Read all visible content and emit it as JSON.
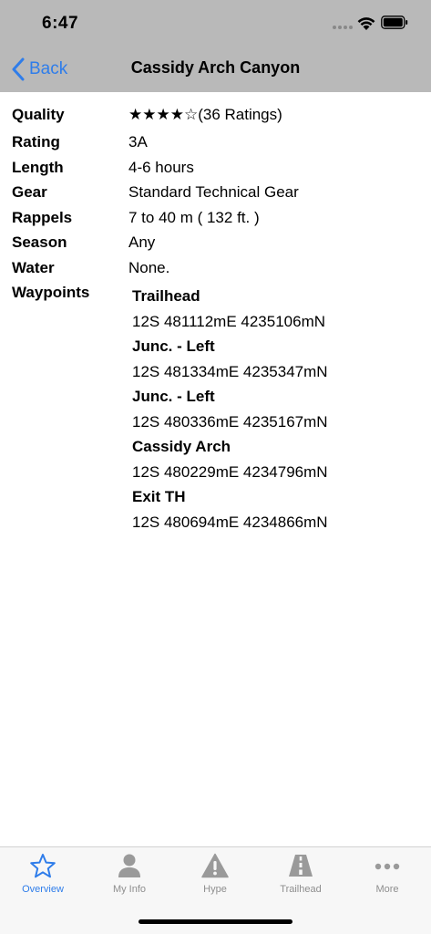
{
  "status_bar": {
    "time": "6:47"
  },
  "nav": {
    "back_label": "Back",
    "title": "Cassidy Arch Canyon"
  },
  "details": [
    {
      "label": "Quality",
      "value": "★★★★☆(36 Ratings)"
    },
    {
      "label": "Rating",
      "value": "3A"
    },
    {
      "label": "Length",
      "value": "4-6 hours"
    },
    {
      "label": "Gear",
      "value": "Standard Technical Gear"
    },
    {
      "label": "Rappels",
      "value": "7 to 40 m ( 132 ft. )"
    },
    {
      "label": "Season",
      "value": "Any"
    },
    {
      "label": "Water",
      "value": "None."
    },
    {
      "label": "Waypoints",
      "value": ""
    }
  ],
  "waypoints": [
    {
      "name": "Trailhead",
      "coord": "12S 481112mE 4235106mN"
    },
    {
      "name": "Junc. - Left",
      "coord": "12S 481334mE 4235347mN"
    },
    {
      "name": "Junc. - Left",
      "coord": "12S 480336mE 4235167mN"
    },
    {
      "name": "Cassidy Arch",
      "coord": "12S 480229mE 4234796mN"
    },
    {
      "name": "Exit TH",
      "coord": "12S 480694mE 4234866mN"
    }
  ],
  "tabs": [
    {
      "label": "Overview",
      "icon": "star-icon",
      "active": true
    },
    {
      "label": "My Info",
      "icon": "person-icon",
      "active": false
    },
    {
      "label": "Hype",
      "icon": "warning-icon",
      "active": false
    },
    {
      "label": "Trailhead",
      "icon": "road-icon",
      "active": false
    },
    {
      "label": "More",
      "icon": "more-icon",
      "active": false
    }
  ],
  "colors": {
    "accent": "#2f7dea",
    "header_bg": "#b9b9b9",
    "tab_inactive": "#8e8e8e"
  }
}
